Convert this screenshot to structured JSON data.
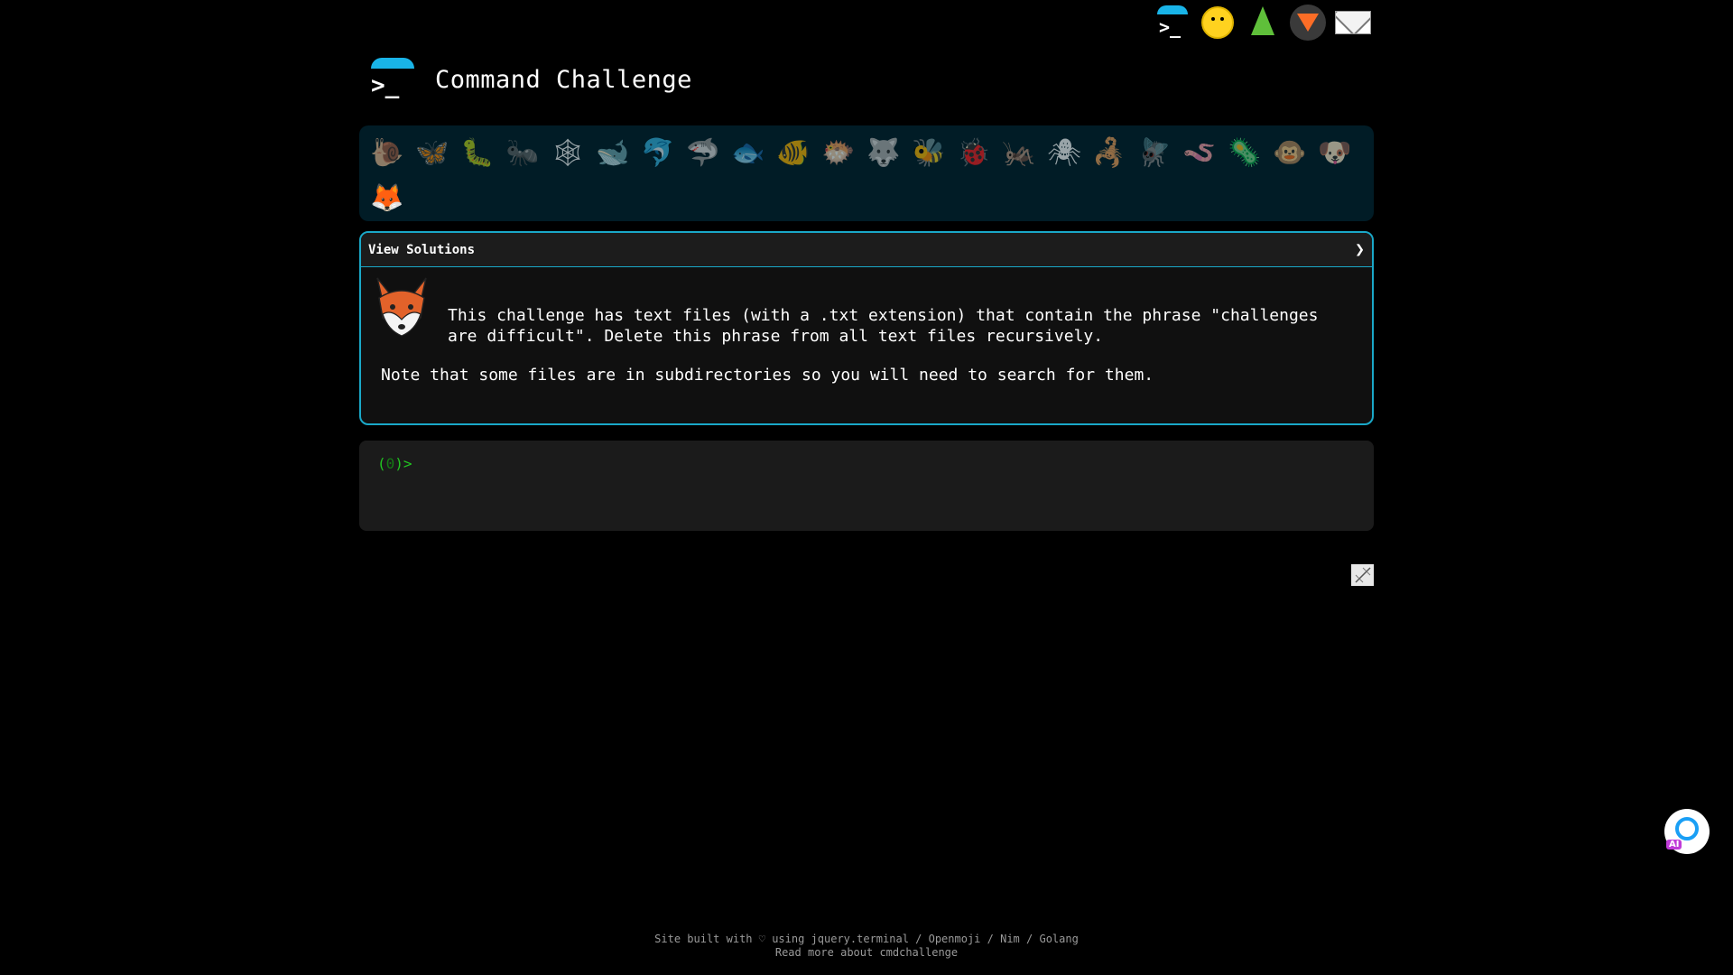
{
  "header": {
    "title": "Command Challenge"
  },
  "nav": {
    "icons": [
      "terminal-logo-icon",
      "shushing-face-icon",
      "tree-icon",
      "gitlab-icon",
      "mail-icon"
    ]
  },
  "challenges": [
    {
      "icon": "snail",
      "glyph": "🐌"
    },
    {
      "icon": "butterfly",
      "glyph": "🦋"
    },
    {
      "icon": "caterpillar",
      "glyph": "🐛"
    },
    {
      "icon": "ant",
      "glyph": "🐜"
    },
    {
      "icon": "spider-web",
      "glyph": "🕸"
    },
    {
      "icon": "whale",
      "glyph": "🐋"
    },
    {
      "icon": "dolphin",
      "glyph": "🐬"
    },
    {
      "icon": "shark",
      "glyph": "🦈"
    },
    {
      "icon": "fish",
      "glyph": "🐟"
    },
    {
      "icon": "tropical-fish",
      "glyph": "🐠"
    },
    {
      "icon": "pufferfish",
      "glyph": "🐡"
    },
    {
      "icon": "wolf",
      "glyph": "🐺"
    },
    {
      "icon": "bee",
      "glyph": "🐝"
    },
    {
      "icon": "ladybug",
      "glyph": "🐞"
    },
    {
      "icon": "cricket",
      "glyph": "🦗"
    },
    {
      "icon": "spider",
      "glyph": "🕷"
    },
    {
      "icon": "scorpion",
      "glyph": "🦂"
    },
    {
      "icon": "fly",
      "glyph": "🪰"
    },
    {
      "icon": "worm",
      "glyph": "🪱"
    },
    {
      "icon": "microbe",
      "glyph": "🦠"
    },
    {
      "icon": "monkey",
      "glyph": "🐵"
    },
    {
      "icon": "dog",
      "glyph": "🐶"
    },
    {
      "icon": "fox",
      "glyph": "🦊",
      "active": true
    }
  ],
  "panel": {
    "title": "View Solutions",
    "toggle": "❯",
    "description": "This challenge has text files (with a .txt extension) that contain the phrase \"challenges are difficult\". Delete this phrase from all text files recursively.",
    "note": "Note that some files are in subdirectories so you will need to search for them."
  },
  "terminal": {
    "prompt_open": "(",
    "prompt_count": "0",
    "prompt_close": ")>"
  },
  "ai_button": {
    "badge": "AI"
  },
  "footer": {
    "line1_prefix": "Site built with ♡ using ",
    "line1_link1": "jquery.terminal",
    "line1_sep1": " / ",
    "line1_link2": "Openmoji",
    "line1_sep2": " / ",
    "line1_link3": "Nim",
    "line1_sep3": " / ",
    "line1_link4": "Golang",
    "line2_prefix": "Read more about ",
    "line2_link": "cmdchallenge"
  },
  "colors": {
    "accent": "#1aa8c8",
    "prompt": "#21c421",
    "bar": "#011c26"
  }
}
